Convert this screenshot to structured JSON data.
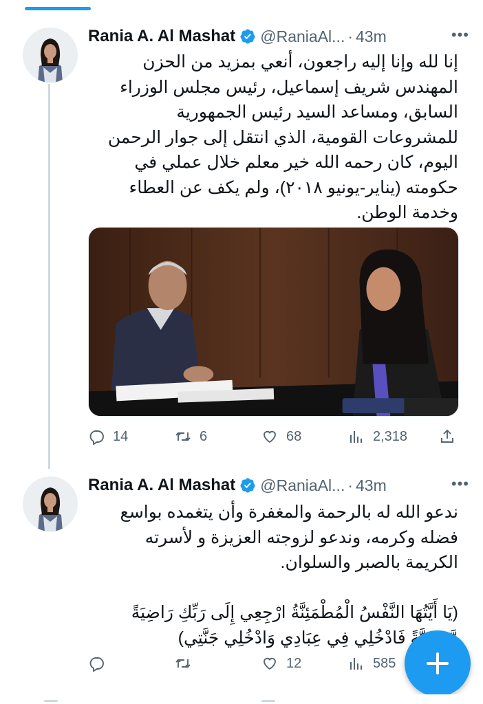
{
  "colors": {
    "accent": "#1d9bf0",
    "muted": "#536471",
    "text": "#0f1419",
    "divider": "#cfd9de"
  },
  "tweets": [
    {
      "author_name": "Rania A. Al Mashat",
      "handle": "@RaniaAl...",
      "separator": "·",
      "time": "43m",
      "more": "•••",
      "text": "إنا لله وإنا إليه راجعون، أنعي بمزيد من الحزن\nالمهندس شريف إسماعيل، رئيس مجلس الوزراء\nالسابق، ومساعد السيد رئيس الجمهورية\nللمشروعات القومية، الذي انتقل إلى جوار الرحمن\nاليوم، كان رحمه الله خير معلم خلال عملي في\nحكومته (يناير-يونيو ٢٠١٨)، ولم يكف عن العطاء\nوخدمة الوطن.",
      "has_media": true,
      "replies": "14",
      "retweets": "6",
      "likes": "68",
      "views": "2,318"
    },
    {
      "author_name": "Rania A. Al Mashat",
      "handle": "@RaniaAl...",
      "separator": "·",
      "time": "43m",
      "more": "•••",
      "text": "ندعو الله له بالرحمة والمغفرة وأن يتغمده بواسع\nفضله وكرمه، وندعو لزوجته العزيزة و لأسرته\nالكريمة بالصبر والسلوان.\n\n(يَا أَيَّتُهَا النَّفْسُ الْمُطْمَئِنَّةُ ارْجِعِي إِلَى رَبِّكِ رَاضِيَةً\nمَّرْضِيَّةً فَادْخُلِي فِي عِبَادِي وَادْخُلِي جَنَّتِي)",
      "has_media": false,
      "replies": "",
      "retweets": "",
      "likes": "12",
      "views": "585"
    }
  ],
  "icons": {
    "avatar": "avatar-photo",
    "verified": "verified-badge-icon",
    "reply": "reply-icon",
    "retweet": "retweet-icon",
    "like": "heart-icon",
    "views": "views-chart-icon",
    "share": "share-icon",
    "compose": "plus-icon"
  }
}
